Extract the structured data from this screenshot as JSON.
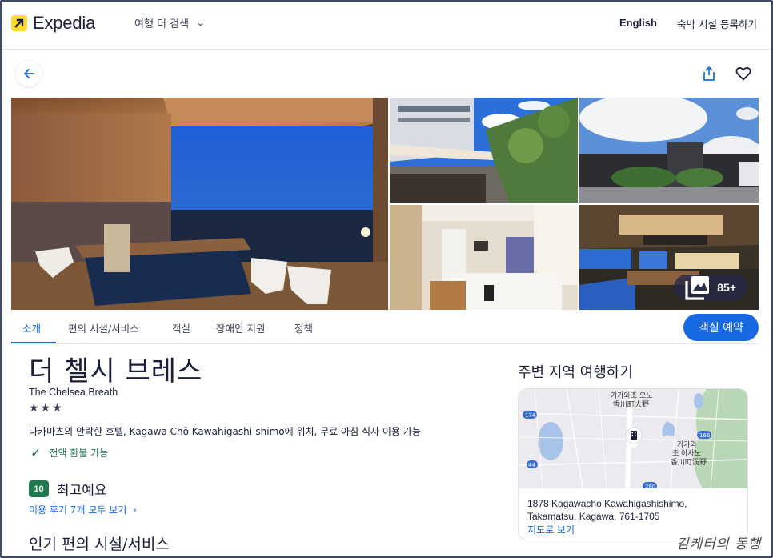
{
  "header": {
    "brand": "Expedia",
    "more_travel": "여행 더 검색",
    "language": "English",
    "list_property": "숙박 시설 등록하기"
  },
  "gallery": {
    "photo_count": "85+",
    "photos": [
      {
        "alt": "open-air bath with night view"
      },
      {
        "alt": "rooftop terrace"
      },
      {
        "alt": "hotel exterior"
      },
      {
        "alt": "guest room"
      },
      {
        "alt": "restaurant lounge"
      }
    ]
  },
  "tabs": [
    {
      "label": "소개",
      "active": true
    },
    {
      "label": "편의 시설/서비스",
      "active": false
    },
    {
      "label": "객실",
      "active": false
    },
    {
      "label": "장애인 지원",
      "active": false
    },
    {
      "label": "정책",
      "active": false
    }
  ],
  "reserve_button": "객실 예약",
  "property": {
    "name_ko": "더 첼시 브레스",
    "name_en": "The Chelsea Breath",
    "stars": 3,
    "stars_text": "★★★",
    "description": "다카마츠의 안락한 호텔, Kagawa Chō Kawahigashi-shimo에 위치, 무료 아침 식사 이용 가능",
    "refund": "전액 환불 가능",
    "rating_score": "10",
    "rating_label": "최고예요",
    "reviews_link": "이용 후기 7개 모두 보기",
    "amenities_title": "인기 편의 시설/서비스"
  },
  "explore": {
    "title": "주변 지역 여행하기",
    "map_labels": {
      "area1_ko": "가가와초 오노",
      "area1_ja": "香川町大野",
      "area2_ko1": "가가와",
      "area2_ko2": "초 아사노",
      "area2_ja": "香川町浅野",
      "road_174": "174",
      "road_166": "166",
      "road_44": "44",
      "road_280": "280"
    },
    "address_line1": "1878 Kagawacho Kawahigashishimo,",
    "address_line2": "Takamatsu, Kagawa, 761-1705",
    "map_link": "지도로 보기"
  },
  "watermark": "김케터의 동행",
  "colors": {
    "brand_yellow": "#fddb32",
    "primary_blue": "#1668e3",
    "rating_green": "#227950",
    "text_dark": "#191e3b"
  }
}
